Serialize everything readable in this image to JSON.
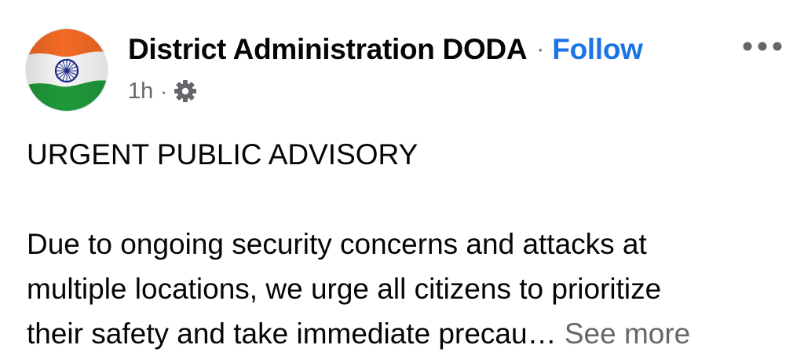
{
  "post": {
    "author_name": "District Administration DODA",
    "separator": "·",
    "follow_label": "Follow",
    "timestamp": "1h",
    "meta_separator": "·",
    "privacy_icon": "gear-icon",
    "more_icon": "more-horizontal-icon",
    "avatar_icon": "indian-flag",
    "headline": "URGENT PUBLIC ADVISORY",
    "body_lines": [
      "Due to ongoing security concerns and attacks at",
      "multiple locations, we urge all citizens to prioritize",
      "their safety and take immediate precau… "
    ],
    "see_more_label": "See more"
  },
  "colors": {
    "text": "#050505",
    "secondary": "#65676b",
    "link": "#1b74e4",
    "saffron": "#f26a24",
    "green": "#1f9a3a",
    "chakra": "#1b2a8c"
  }
}
